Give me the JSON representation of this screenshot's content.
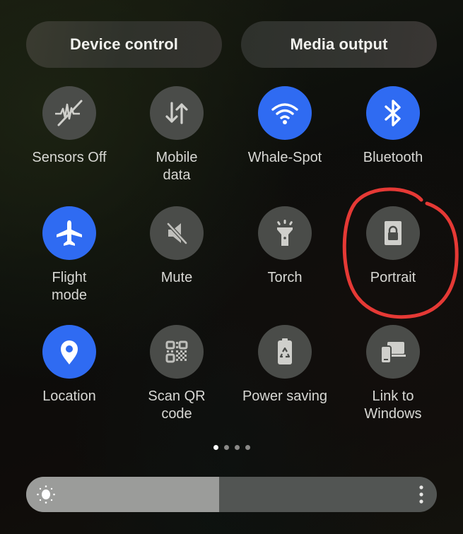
{
  "top_buttons": {
    "device_control": "Device control",
    "media_output": "Media output"
  },
  "tiles": [
    {
      "label": "Sensors Off",
      "icon": "sensors-off-icon",
      "state": "off"
    },
    {
      "label": "Mobile\ndata",
      "icon": "mobile-data-icon",
      "state": "off"
    },
    {
      "label": "Whale-Spot",
      "icon": "wifi-icon",
      "state": "on"
    },
    {
      "label": "Bluetooth",
      "icon": "bluetooth-icon",
      "state": "on"
    },
    {
      "label": "Flight\nmode",
      "icon": "airplane-icon",
      "state": "on"
    },
    {
      "label": "Mute",
      "icon": "mute-icon",
      "state": "off"
    },
    {
      "label": "Torch",
      "icon": "flashlight-icon",
      "state": "off"
    },
    {
      "label": "Portrait",
      "icon": "rotation-lock-icon",
      "state": "off"
    },
    {
      "label": "Location",
      "icon": "location-pin-icon",
      "state": "on"
    },
    {
      "label": "Scan QR\ncode",
      "icon": "qr-code-icon",
      "state": "off"
    },
    {
      "label": "Power saving",
      "icon": "power-saving-icon",
      "state": "off"
    },
    {
      "label": "Link to\nWindows",
      "icon": "link-to-windows-icon",
      "state": "off"
    }
  ],
  "pagination": {
    "pages": 4,
    "current": 1
  },
  "brightness": {
    "icon": "sun-icon",
    "level_percent": 47,
    "more_icon": "more-vertical-icon"
  },
  "colors": {
    "active": "#2f6bf2",
    "inactive": "#4a4c49",
    "annotation": "#e53935"
  },
  "annotation": {
    "target": "Portrait",
    "shape": "hand-drawn circle"
  }
}
